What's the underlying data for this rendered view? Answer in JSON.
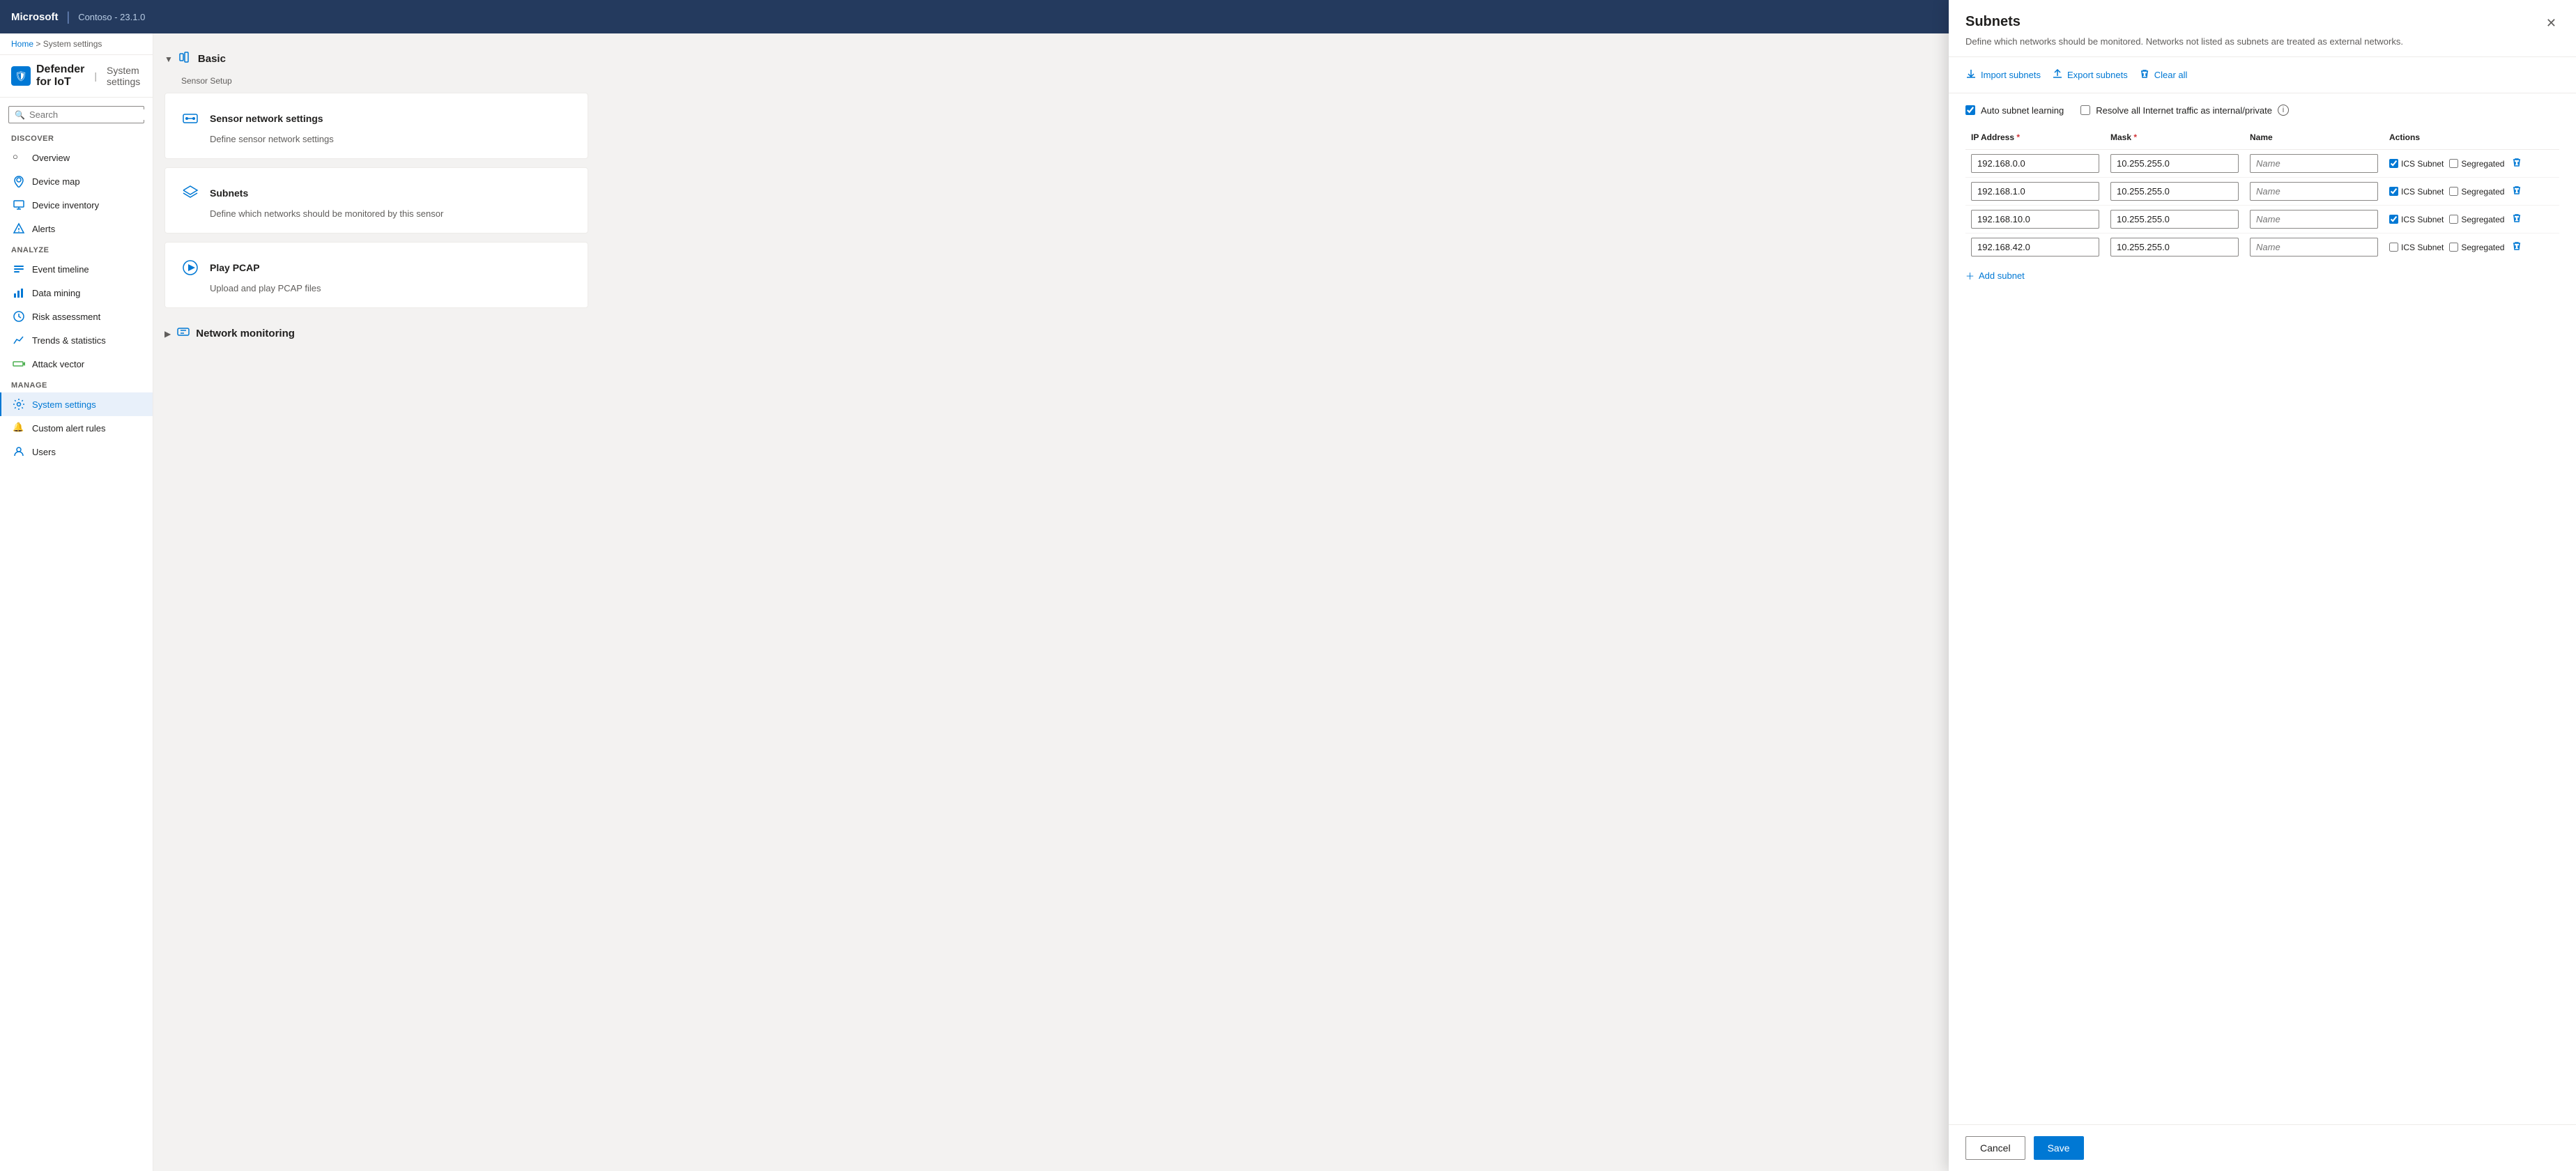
{
  "topbar": {
    "brand": "Microsoft",
    "separator": "|",
    "instance": "Contoso - 23.1.0"
  },
  "breadcrumb": {
    "home": "Home",
    "separator": ">",
    "current": "System settings"
  },
  "page_title": {
    "icon": "🛡",
    "title": "Defender for IoT",
    "separator": "|",
    "subtitle": "System settings"
  },
  "search": {
    "placeholder": "Search"
  },
  "sidebar": {
    "discover_label": "Discover",
    "nav_items": [
      {
        "id": "overview",
        "label": "Overview",
        "icon": "○"
      },
      {
        "id": "device-map",
        "label": "Device map",
        "icon": "📍"
      },
      {
        "id": "device-inventory",
        "label": "Device inventory",
        "icon": "🖥"
      },
      {
        "id": "alerts",
        "label": "Alerts",
        "icon": "🔔"
      }
    ],
    "analyze_label": "Analyze",
    "analyze_items": [
      {
        "id": "event-timeline",
        "label": "Event timeline",
        "icon": "📅"
      },
      {
        "id": "data-mining",
        "label": "Data mining",
        "icon": "📊"
      },
      {
        "id": "risk-assessment",
        "label": "Risk assessment",
        "icon": "⚠"
      },
      {
        "id": "trends-statistics",
        "label": "Trends & statistics",
        "icon": "📈"
      },
      {
        "id": "attack-vector",
        "label": "Attack vector",
        "icon": "🎯"
      }
    ],
    "manage_label": "Manage",
    "manage_items": [
      {
        "id": "system-settings",
        "label": "System settings",
        "icon": "⚙",
        "active": true
      },
      {
        "id": "custom-alert-rules",
        "label": "Custom alert rules",
        "icon": "🔔"
      },
      {
        "id": "users",
        "label": "Users",
        "icon": "👤"
      }
    ]
  },
  "settings_sections": {
    "basic": {
      "label": "Basic",
      "sub_label": "Sensor Setup",
      "cards": [
        {
          "id": "sensor-network-settings",
          "title": "Sensor network settings",
          "desc": "Define sensor network settings",
          "icon": "📶"
        },
        {
          "id": "subnets",
          "title": "Subnets",
          "desc": "Define which networks should be monitored by this sensor",
          "icon": "<>"
        },
        {
          "id": "play-pcap",
          "title": "Play PCAP",
          "desc": "Upload and play PCAP files",
          "icon": "▶"
        }
      ]
    },
    "network_monitoring": {
      "label": "Network monitoring"
    }
  },
  "panel": {
    "title": "Subnets",
    "desc": "Define which networks should be monitored. Networks not listed as subnets are treated as external networks.",
    "toolbar": {
      "import_label": "Import subnets",
      "export_label": "Export subnets",
      "clear_all_label": "Clear all"
    },
    "options": {
      "auto_subnet_learning": "Auto subnet learning",
      "resolve_internet_traffic": "Resolve all Internet traffic as internal/private"
    },
    "table": {
      "columns": [
        "IP Address",
        "Mask",
        "Name",
        "Actions"
      ],
      "rows": [
        {
          "ip": "192.168.0.0",
          "mask": "10.255.255.0",
          "name": "",
          "ics_checked": true,
          "seg_checked": false
        },
        {
          "ip": "192.168.1.0",
          "mask": "10.255.255.0",
          "name": "",
          "ics_checked": true,
          "seg_checked": false
        },
        {
          "ip": "192.168.10.0",
          "mask": "10.255.255.0",
          "name": "",
          "ics_checked": true,
          "seg_checked": false
        },
        {
          "ip": "192.168.42.0",
          "mask": "10.255.255.0",
          "name": "",
          "ics_checked": false,
          "seg_checked": false
        }
      ],
      "name_placeholder": "Name",
      "ics_label": "ICS Subnet",
      "segregated_label": "Segregated"
    },
    "add_subnet_label": "+ Add subnet",
    "footer": {
      "cancel_label": "Cancel",
      "save_label": "Save"
    }
  }
}
